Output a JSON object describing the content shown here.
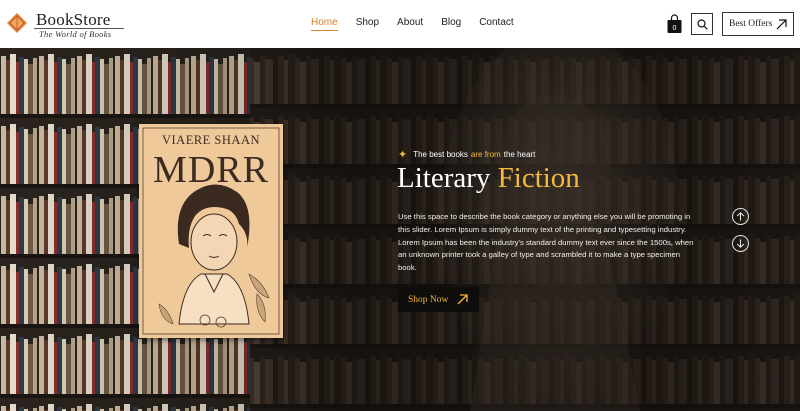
{
  "brand": {
    "name": "BookStore",
    "tagline": "The World of Books",
    "logo_icon": "diamond-book-icon",
    "accent": "#d4802a"
  },
  "nav": {
    "items": [
      {
        "label": "Home",
        "active": true
      },
      {
        "label": "Shop",
        "active": false
      },
      {
        "label": "About",
        "active": false
      },
      {
        "label": "Blog",
        "active": false
      },
      {
        "label": "Contact",
        "active": false
      }
    ]
  },
  "header": {
    "cart_count": "0",
    "cart_icon": "shopping-bag-icon",
    "search_icon": "search-icon",
    "offers_label": "Best Offers",
    "offers_icon": "arrow-up-right-icon"
  },
  "hero": {
    "book_cover": {
      "author": "VIAERE SHAAN",
      "title": "MDRR",
      "color": "#f0c99a"
    },
    "kicker_pre": "The best books",
    "kicker_hl": "are from",
    "kicker_post": "the heart",
    "kicker_icon": "sparkle-icon",
    "headline_main": "Literary",
    "headline_accent": "Fiction",
    "accent_color": "#f4b93a",
    "description": "Use this space to describe the book category or anything else you will be promoting in this slider. Lorem Ipsum is simply dummy text of the printing and typesetting industry. Lorem Ipsum has been the industry's standard dummy text ever since the 1500s, when an unknown printer took a galley of type and scrambled it to make  a type specimen book.",
    "cta_label": "Shop Now",
    "cta_icon": "arrow-up-right-icon",
    "prev_icon": "arrow-up-circle-icon",
    "next_icon": "arrow-down-circle-icon"
  }
}
